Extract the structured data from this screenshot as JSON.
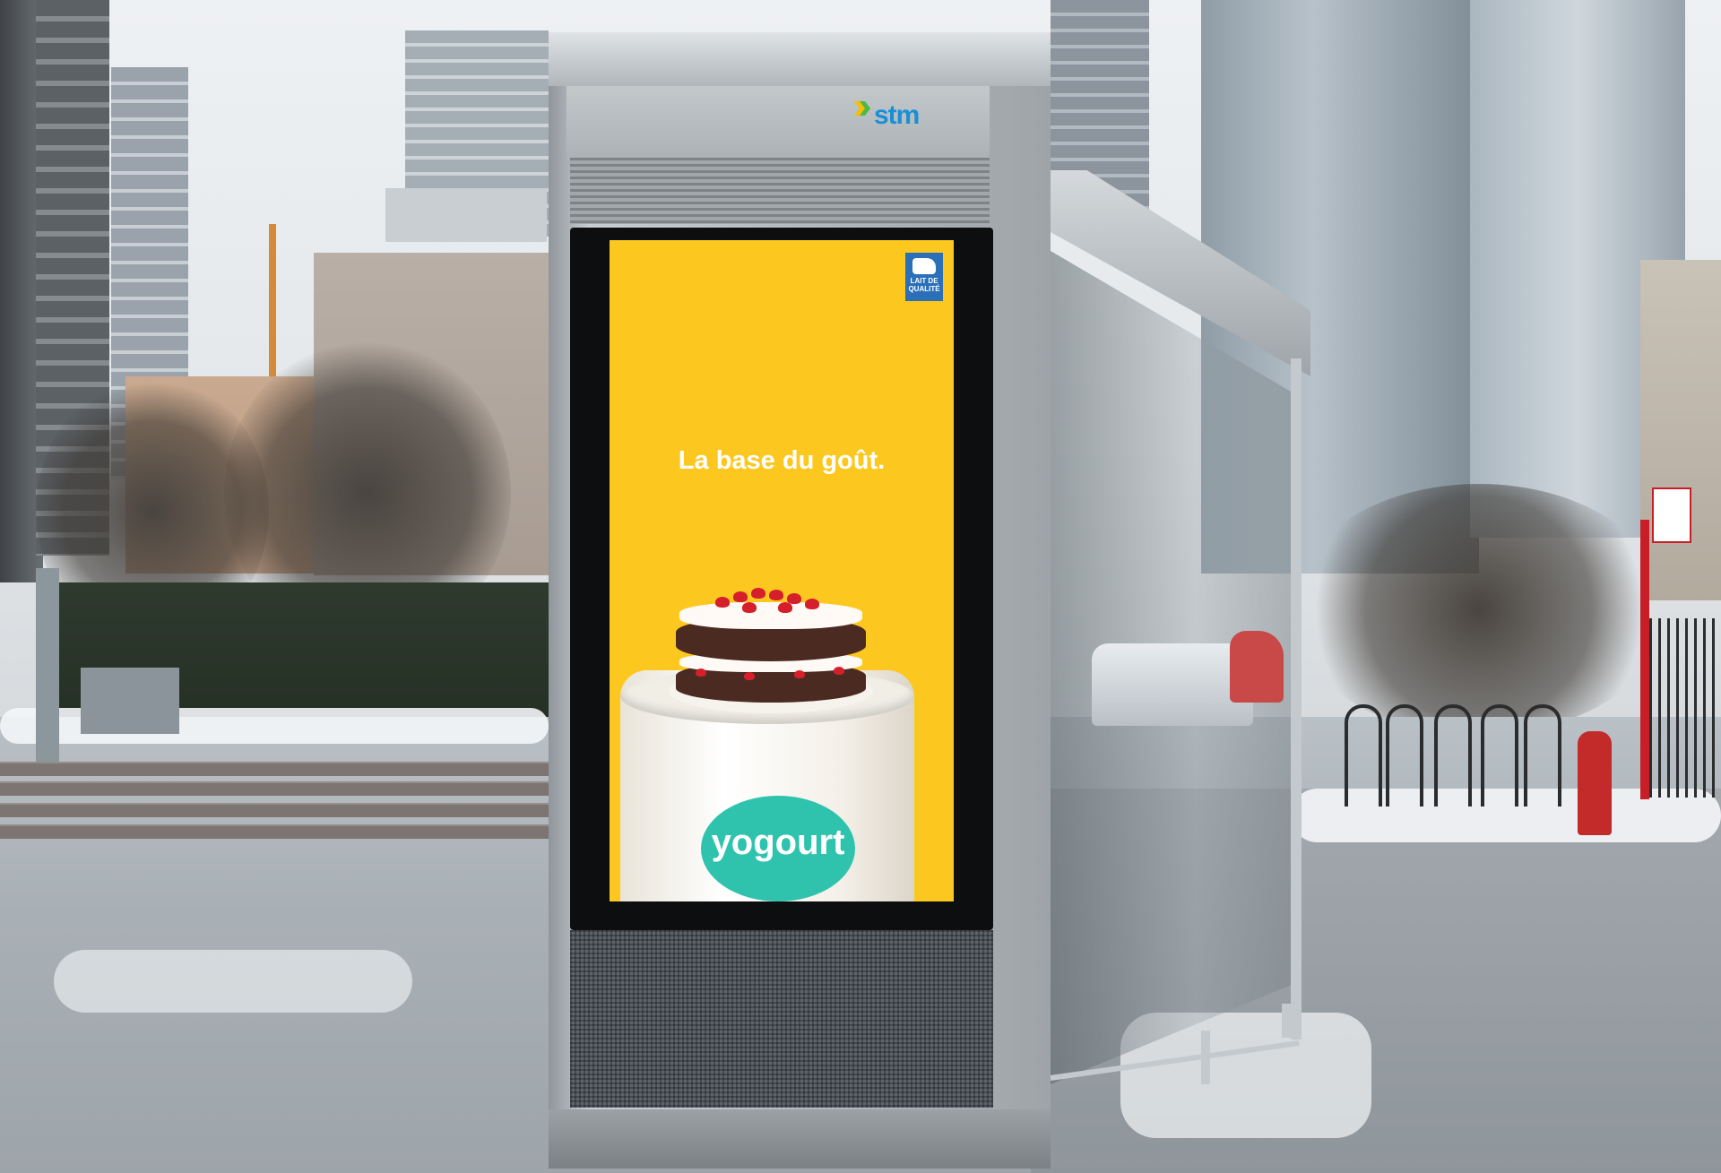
{
  "scene": {
    "description_label": "bus shelter advertising screen"
  },
  "kiosk": {
    "brand_logo": "stm"
  },
  "ad": {
    "headline": "La base du goût.",
    "product_label": "yogourt",
    "badge_text": "LAIT DE QUALITÉ",
    "background_color": "#fcc81f",
    "accent_color": "#2fc3ae"
  },
  "colors": {
    "stm_blue": "#1a8fd6",
    "hydrant_red": "#c32a2a"
  }
}
